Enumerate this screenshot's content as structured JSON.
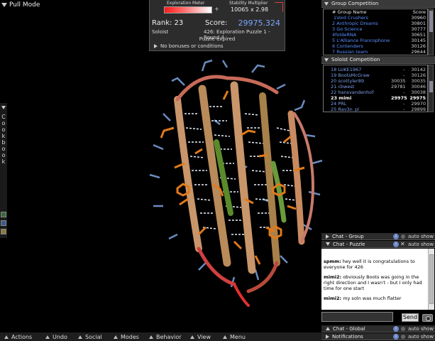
{
  "pull_mode": {
    "label": "Pull Mode"
  },
  "score_panel": {
    "exploration_meter_label": "Exploration Meter",
    "exploration_meter_level": 0.3,
    "exploration_plus": "+",
    "stability_label": "Stability Multiplier",
    "stability_value": "10065  x  2.98",
    "rank": "Rank: 23",
    "score_label": "Score:",
    "score_value": "29975.324",
    "mode": "Soloist",
    "puzzle_name": "426: Exploration Puzzle 1 - Round 4",
    "puzzle_status": "Puzzle expired",
    "bonus_text": "No bonuses or conditions"
  },
  "group_competition": {
    "title": "Group Competition",
    "col_name": "# Group Name",
    "col_score": "Score",
    "rows": [
      {
        "name": "1Void Crushers",
        "score": "30960"
      },
      {
        "name": "2 Anthropic Dreams",
        "score": "30801"
      },
      {
        "name": "3 Go Science",
        "score": "30777"
      },
      {
        "name": "4foldeRNA",
        "score": "30651"
      },
      {
        "name": "5 L'Alliance Francophone",
        "score": "30145"
      },
      {
        "name": "6 Contenders",
        "score": "30126"
      },
      {
        "name": "7 Russian team",
        "score": "29644"
      }
    ]
  },
  "soloist_competition": {
    "title": "Soloist Competition",
    "rows": [
      {
        "name": "18 LUKE1967",
        "a": "-",
        "b": "30142"
      },
      {
        "name": "19 BootsMcGraw",
        "a": "-",
        "b": "30126"
      },
      {
        "name": "20 scottyler89",
        "a": "30035",
        "b": "30035"
      },
      {
        "name": "21 cbwest",
        "a": "29781",
        "b": "30046"
      },
      {
        "name": "22 hansvandenhof",
        "a": "-",
        "b": "30038"
      },
      {
        "name": "23 mimi",
        "a": "29975",
        "b": "29975"
      },
      {
        "name": "24 PRL",
        "a": "-",
        "b": "29970"
      },
      {
        "name": "25 Rav3n_pl",
        "a": "-",
        "b": "29899"
      }
    ]
  },
  "chat": {
    "group_label": "Chat - Group",
    "puzzle_label": "Chat - Puzzle",
    "global_label": "Chat - Global",
    "notifications_label": "Notifications",
    "auto_show": "auto show",
    "info_glyph": "i",
    "close_glyph": "✕",
    "send_label": "Send",
    "messages": [
      {
        "user": "spmm:",
        "text": " hey well it is congratulations  to everyone for 426"
      },
      {
        "user": "mimi2:",
        "text": " obviously Boots was going in the right direction and I wasn't - but I only had time for one start"
      },
      {
        "user": "mimi2:",
        "text": " my soln was much flatter"
      }
    ]
  },
  "cookbook": {
    "label": "Cookbook"
  },
  "bottom_menu": {
    "actions": "Actions",
    "undo": "Undo",
    "social": "Social",
    "modes": "Modes",
    "behavior": "Behavior",
    "view": "View",
    "menu": "Menu"
  },
  "colors": {
    "panel_bg": "#2c2c2c",
    "score_blue": "#7aa6ff",
    "group_name_blue": "#5a8fff",
    "strand_tan": "#c8966a",
    "sidechain_orange": "#e07a1c",
    "sidechain_blue": "#6a8cc0",
    "hbond_white": "#e8f0ff"
  }
}
